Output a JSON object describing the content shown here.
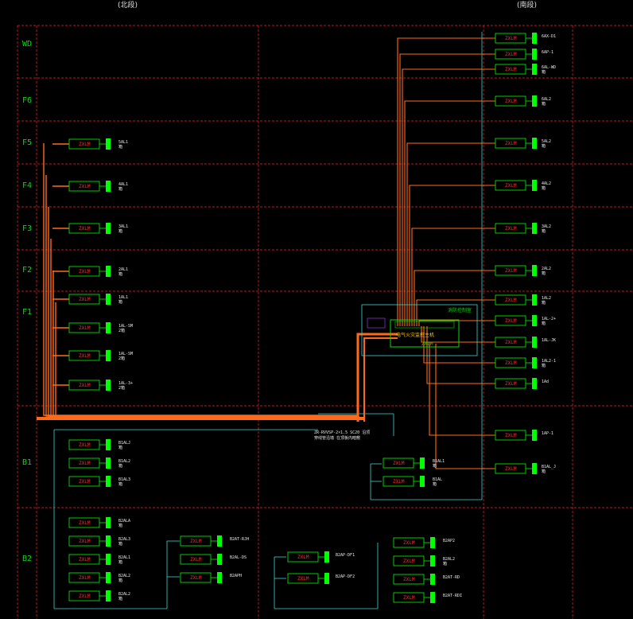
{
  "titles": {
    "left": "(北段)",
    "right": "(南段)"
  },
  "floors": [
    "WD",
    "F6",
    "F5",
    "F4",
    "F3",
    "F2",
    "F1",
    "B1",
    "B2"
  ],
  "module_label": "ZXLM",
  "left_devices": [
    {
      "module": "ZXLM",
      "tag": "5AL1",
      "sub": "箱"
    },
    {
      "module": "ZXLM",
      "tag": "4AL1",
      "sub": "箱"
    },
    {
      "module": "ZXLM",
      "tag": "3AL1",
      "sub": "箱"
    },
    {
      "module": "ZXLM",
      "tag": "2AL1",
      "sub": "箱"
    },
    {
      "module": "ZXLM",
      "tag": "1AL1",
      "sub": "箱"
    },
    {
      "module": "ZXLM",
      "tag": "1AL-SM",
      "sub": "2箱"
    },
    {
      "module": "ZXLM",
      "tag": "1AL-SM",
      "sub": "2箱"
    },
    {
      "module": "ZXLM",
      "tag": "1AL-3+",
      "sub": "2箱"
    }
  ],
  "right_devices": [
    {
      "module": "ZXLM",
      "tag": "6AX-D1",
      "sub": ""
    },
    {
      "module": "ZXLM",
      "tag": "6AP-1",
      "sub": ""
    },
    {
      "module": "ZXLM",
      "tag": "6AL-WD",
      "sub": "箱"
    },
    {
      "module": "ZXLM",
      "tag": "6AL2",
      "sub": "箱"
    },
    {
      "module": "ZXLM",
      "tag": "5AL2",
      "sub": "箱"
    },
    {
      "module": "ZXLM",
      "tag": "4AL2",
      "sub": "箱"
    },
    {
      "module": "ZXLM",
      "tag": "3AL2",
      "sub": "箱"
    },
    {
      "module": "ZXLM",
      "tag": "2AL2",
      "sub": "箱"
    },
    {
      "module": "ZXLM",
      "tag": "1AL2",
      "sub": "箱"
    },
    {
      "module": "ZXLM",
      "tag": "1AL-2+",
      "sub": "箱"
    },
    {
      "module": "ZXLM",
      "tag": "1AL-JK",
      "sub": ""
    },
    {
      "module": "ZXLM",
      "tag": "1AL2-1",
      "sub": "箱"
    },
    {
      "module": "ZXLM",
      "tag": "1Ad",
      "sub": ""
    },
    {
      "module": "ZXLM",
      "tag": "1AP-1",
      "sub": ""
    },
    {
      "module": "ZXLM",
      "tag": "B1AL_J",
      "sub": "箱"
    }
  ],
  "b1_left_devices": [
    {
      "module": "ZXLM",
      "tag": "B1ALJ",
      "sub": "箱"
    },
    {
      "module": "ZXLM",
      "tag": "B1AL2",
      "sub": "箱"
    },
    {
      "module": "ZXLM",
      "tag": "B1AL3",
      "sub": "箱"
    }
  ],
  "b1_mid_devices": [
    {
      "module": "ZXLM",
      "tag": "B1AL1",
      "sub": "箱"
    },
    {
      "module": "ZXLM",
      "tag": "B1AL",
      "sub": "箱"
    }
  ],
  "b2_col1": [
    {
      "module": "ZXLM",
      "tag": "B2ALA",
      "sub": "箱"
    },
    {
      "module": "ZXLM",
      "tag": "B2AL3",
      "sub": "箱"
    },
    {
      "module": "ZXLM",
      "tag": "B2AL1",
      "sub": "箱"
    },
    {
      "module": "ZXLM",
      "tag": "B2AL2",
      "sub": "箱"
    },
    {
      "module": "ZXLM",
      "tag": "B2AL2",
      "sub": "箱"
    }
  ],
  "b2_col2": [
    {
      "module": "ZXLM",
      "tag": "B2AT-RJH",
      "sub": ""
    },
    {
      "module": "ZXLM",
      "tag": "B2AL-DS",
      "sub": ""
    },
    {
      "module": "ZXLM",
      "tag": "B2APH",
      "sub": ""
    }
  ],
  "b2_col3": [
    {
      "module": "ZXLM",
      "tag": "B2AP-DF1",
      "sub": ""
    },
    {
      "module": "ZXLM",
      "tag": "B2AP-DF2",
      "sub": ""
    }
  ],
  "b2_col4": [
    {
      "module": "ZXLM",
      "tag": "B2AP2",
      "sub": ""
    },
    {
      "module": "ZXLM",
      "tag": "B2AL2",
      "sub": "箱"
    },
    {
      "module": "ZXLM",
      "tag": "B2AT-RD",
      "sub": ""
    },
    {
      "module": "ZXLM",
      "tag": "B2AT-RDI",
      "sub": ""
    }
  ],
  "control_room": {
    "title": "消防控制室",
    "panel": "电气火灾监控主机",
    "panel_code": "ZXLM",
    "note": "ZR-RVVSP-2×1.5 SC20 沿顶",
    "note2": "穿线管沿墙 在顶板内暗敷"
  },
  "colors": {
    "background": "#000000",
    "grid": "#ff2020",
    "floor_text": "#00e000",
    "module_border": "#00e000",
    "module_text": "#ff2a2a",
    "bus": "#ff6a1a",
    "cyan": "#3ad4d4",
    "terminal": "#00ff00"
  }
}
